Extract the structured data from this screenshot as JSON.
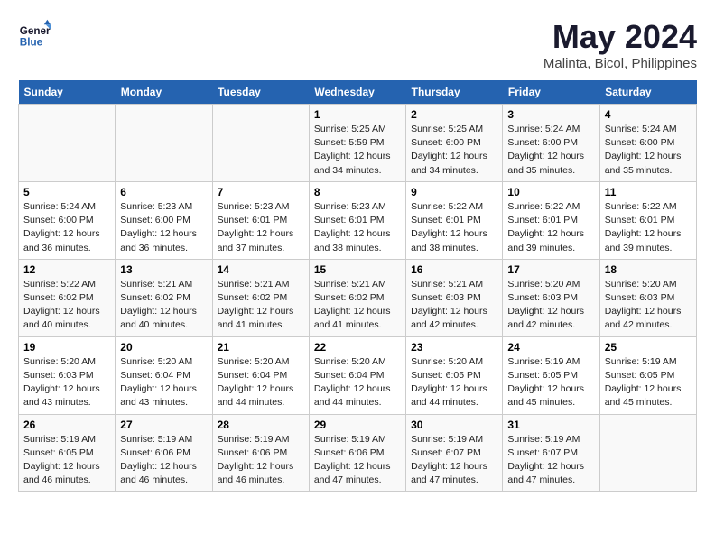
{
  "header": {
    "logo_line1": "General",
    "logo_line2": "Blue",
    "month": "May 2024",
    "location": "Malinta, Bicol, Philippines"
  },
  "days_of_week": [
    "Sunday",
    "Monday",
    "Tuesday",
    "Wednesday",
    "Thursday",
    "Friday",
    "Saturday"
  ],
  "weeks": [
    [
      {
        "num": "",
        "info": ""
      },
      {
        "num": "",
        "info": ""
      },
      {
        "num": "",
        "info": ""
      },
      {
        "num": "1",
        "info": "Sunrise: 5:25 AM\nSunset: 5:59 PM\nDaylight: 12 hours\nand 34 minutes."
      },
      {
        "num": "2",
        "info": "Sunrise: 5:25 AM\nSunset: 6:00 PM\nDaylight: 12 hours\nand 34 minutes."
      },
      {
        "num": "3",
        "info": "Sunrise: 5:24 AM\nSunset: 6:00 PM\nDaylight: 12 hours\nand 35 minutes."
      },
      {
        "num": "4",
        "info": "Sunrise: 5:24 AM\nSunset: 6:00 PM\nDaylight: 12 hours\nand 35 minutes."
      }
    ],
    [
      {
        "num": "5",
        "info": "Sunrise: 5:24 AM\nSunset: 6:00 PM\nDaylight: 12 hours\nand 36 minutes."
      },
      {
        "num": "6",
        "info": "Sunrise: 5:23 AM\nSunset: 6:00 PM\nDaylight: 12 hours\nand 36 minutes."
      },
      {
        "num": "7",
        "info": "Sunrise: 5:23 AM\nSunset: 6:01 PM\nDaylight: 12 hours\nand 37 minutes."
      },
      {
        "num": "8",
        "info": "Sunrise: 5:23 AM\nSunset: 6:01 PM\nDaylight: 12 hours\nand 38 minutes."
      },
      {
        "num": "9",
        "info": "Sunrise: 5:22 AM\nSunset: 6:01 PM\nDaylight: 12 hours\nand 38 minutes."
      },
      {
        "num": "10",
        "info": "Sunrise: 5:22 AM\nSunset: 6:01 PM\nDaylight: 12 hours\nand 39 minutes."
      },
      {
        "num": "11",
        "info": "Sunrise: 5:22 AM\nSunset: 6:01 PM\nDaylight: 12 hours\nand 39 minutes."
      }
    ],
    [
      {
        "num": "12",
        "info": "Sunrise: 5:22 AM\nSunset: 6:02 PM\nDaylight: 12 hours\nand 40 minutes."
      },
      {
        "num": "13",
        "info": "Sunrise: 5:21 AM\nSunset: 6:02 PM\nDaylight: 12 hours\nand 40 minutes."
      },
      {
        "num": "14",
        "info": "Sunrise: 5:21 AM\nSunset: 6:02 PM\nDaylight: 12 hours\nand 41 minutes."
      },
      {
        "num": "15",
        "info": "Sunrise: 5:21 AM\nSunset: 6:02 PM\nDaylight: 12 hours\nand 41 minutes."
      },
      {
        "num": "16",
        "info": "Sunrise: 5:21 AM\nSunset: 6:03 PM\nDaylight: 12 hours\nand 42 minutes."
      },
      {
        "num": "17",
        "info": "Sunrise: 5:20 AM\nSunset: 6:03 PM\nDaylight: 12 hours\nand 42 minutes."
      },
      {
        "num": "18",
        "info": "Sunrise: 5:20 AM\nSunset: 6:03 PM\nDaylight: 12 hours\nand 42 minutes."
      }
    ],
    [
      {
        "num": "19",
        "info": "Sunrise: 5:20 AM\nSunset: 6:03 PM\nDaylight: 12 hours\nand 43 minutes."
      },
      {
        "num": "20",
        "info": "Sunrise: 5:20 AM\nSunset: 6:04 PM\nDaylight: 12 hours\nand 43 minutes."
      },
      {
        "num": "21",
        "info": "Sunrise: 5:20 AM\nSunset: 6:04 PM\nDaylight: 12 hours\nand 44 minutes."
      },
      {
        "num": "22",
        "info": "Sunrise: 5:20 AM\nSunset: 6:04 PM\nDaylight: 12 hours\nand 44 minutes."
      },
      {
        "num": "23",
        "info": "Sunrise: 5:20 AM\nSunset: 6:05 PM\nDaylight: 12 hours\nand 44 minutes."
      },
      {
        "num": "24",
        "info": "Sunrise: 5:19 AM\nSunset: 6:05 PM\nDaylight: 12 hours\nand 45 minutes."
      },
      {
        "num": "25",
        "info": "Sunrise: 5:19 AM\nSunset: 6:05 PM\nDaylight: 12 hours\nand 45 minutes."
      }
    ],
    [
      {
        "num": "26",
        "info": "Sunrise: 5:19 AM\nSunset: 6:05 PM\nDaylight: 12 hours\nand 46 minutes."
      },
      {
        "num": "27",
        "info": "Sunrise: 5:19 AM\nSunset: 6:06 PM\nDaylight: 12 hours\nand 46 minutes."
      },
      {
        "num": "28",
        "info": "Sunrise: 5:19 AM\nSunset: 6:06 PM\nDaylight: 12 hours\nand 46 minutes."
      },
      {
        "num": "29",
        "info": "Sunrise: 5:19 AM\nSunset: 6:06 PM\nDaylight: 12 hours\nand 47 minutes."
      },
      {
        "num": "30",
        "info": "Sunrise: 5:19 AM\nSunset: 6:07 PM\nDaylight: 12 hours\nand 47 minutes."
      },
      {
        "num": "31",
        "info": "Sunrise: 5:19 AM\nSunset: 6:07 PM\nDaylight: 12 hours\nand 47 minutes."
      },
      {
        "num": "",
        "info": ""
      }
    ]
  ]
}
